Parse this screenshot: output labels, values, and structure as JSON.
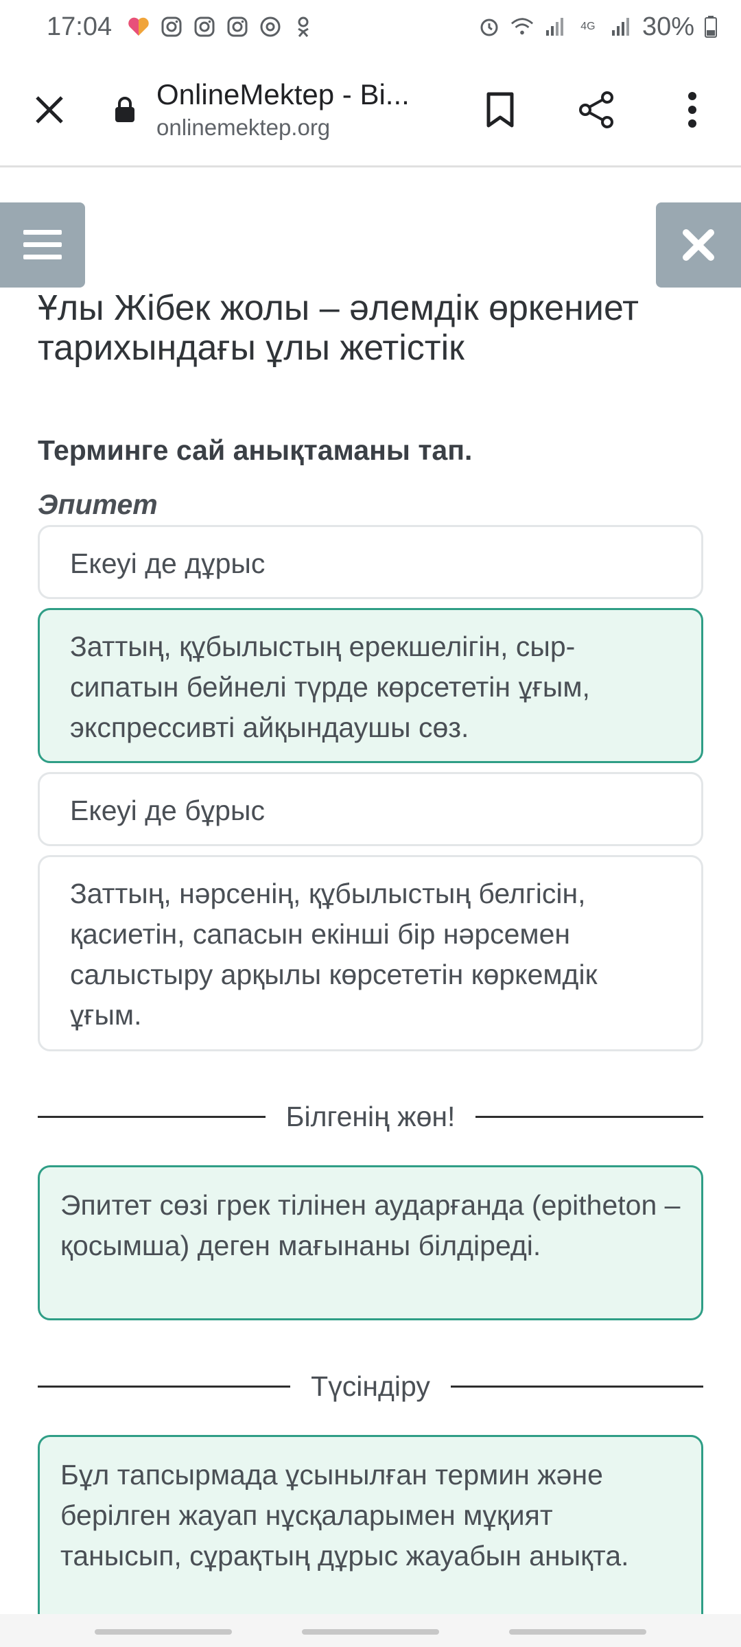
{
  "status_bar": {
    "time": "17:04",
    "battery": "30%",
    "network": "4G",
    "left_icons": [
      "heart-icon",
      "instagram-icon",
      "instagram-icon",
      "instagram-icon",
      "at-icon",
      "odnoklassniki-icon"
    ],
    "right_icons": [
      "alarm-icon",
      "wifi-icon",
      "signal-icon",
      "4g-icon",
      "signal-icon",
      "battery-icon"
    ]
  },
  "browser": {
    "title": "OnlineMektep - Bi...",
    "url": "onlinemektep.org"
  },
  "page": {
    "lesson_title": "Ұлы Жібек жолы – әлемдік өркениет тарихындағы ұлы жетістік",
    "question": "Терминге сай анықтаманы тап.",
    "term": "Эпитет",
    "options": [
      {
        "text": "Екеуі де дұрыс",
        "selected": false
      },
      {
        "text": "Заттың, құбылыстың ерекшелігін, сыр-сипатын бейнелі түрде көрсететін ұғым, экспрессивті айқындаушы сөз.",
        "selected": true
      },
      {
        "text": "Екеуі де бұрыс",
        "selected": false
      },
      {
        "text": "Заттың, нәрсенің, құбылыстың белгісін, қасиетін, сапасын екінші бір нәрсемен салыстыру арқылы көрсететін көркемдік ұғым.",
        "selected": false
      }
    ],
    "did_you_know_label": "Білгенің жөн!",
    "did_you_know_text": "Эпитет сөзі грек тілінен аударғанда (epitheton – қосымша) деген мағынаны білдіреді.",
    "explanation_label": "Түсіндіру",
    "explanation_text": "Бұл тапсырмада ұсынылған термин және берілген жауап нұсқаларымен мұқият танысып, сұрақтың дұрыс жауабын анықта."
  },
  "colors": {
    "accent": "#2f9e86",
    "selected_bg": "#e9f7f1",
    "side_button_bg": "#9aa8b1"
  }
}
